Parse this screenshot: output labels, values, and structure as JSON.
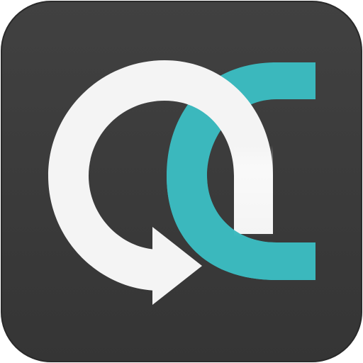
{
  "icon": {
    "name": "app-logo-icon",
    "colors": {
      "background": "#3b3b3b",
      "ring": "#f4f4f4",
      "accent": "#3bb8bd"
    }
  }
}
